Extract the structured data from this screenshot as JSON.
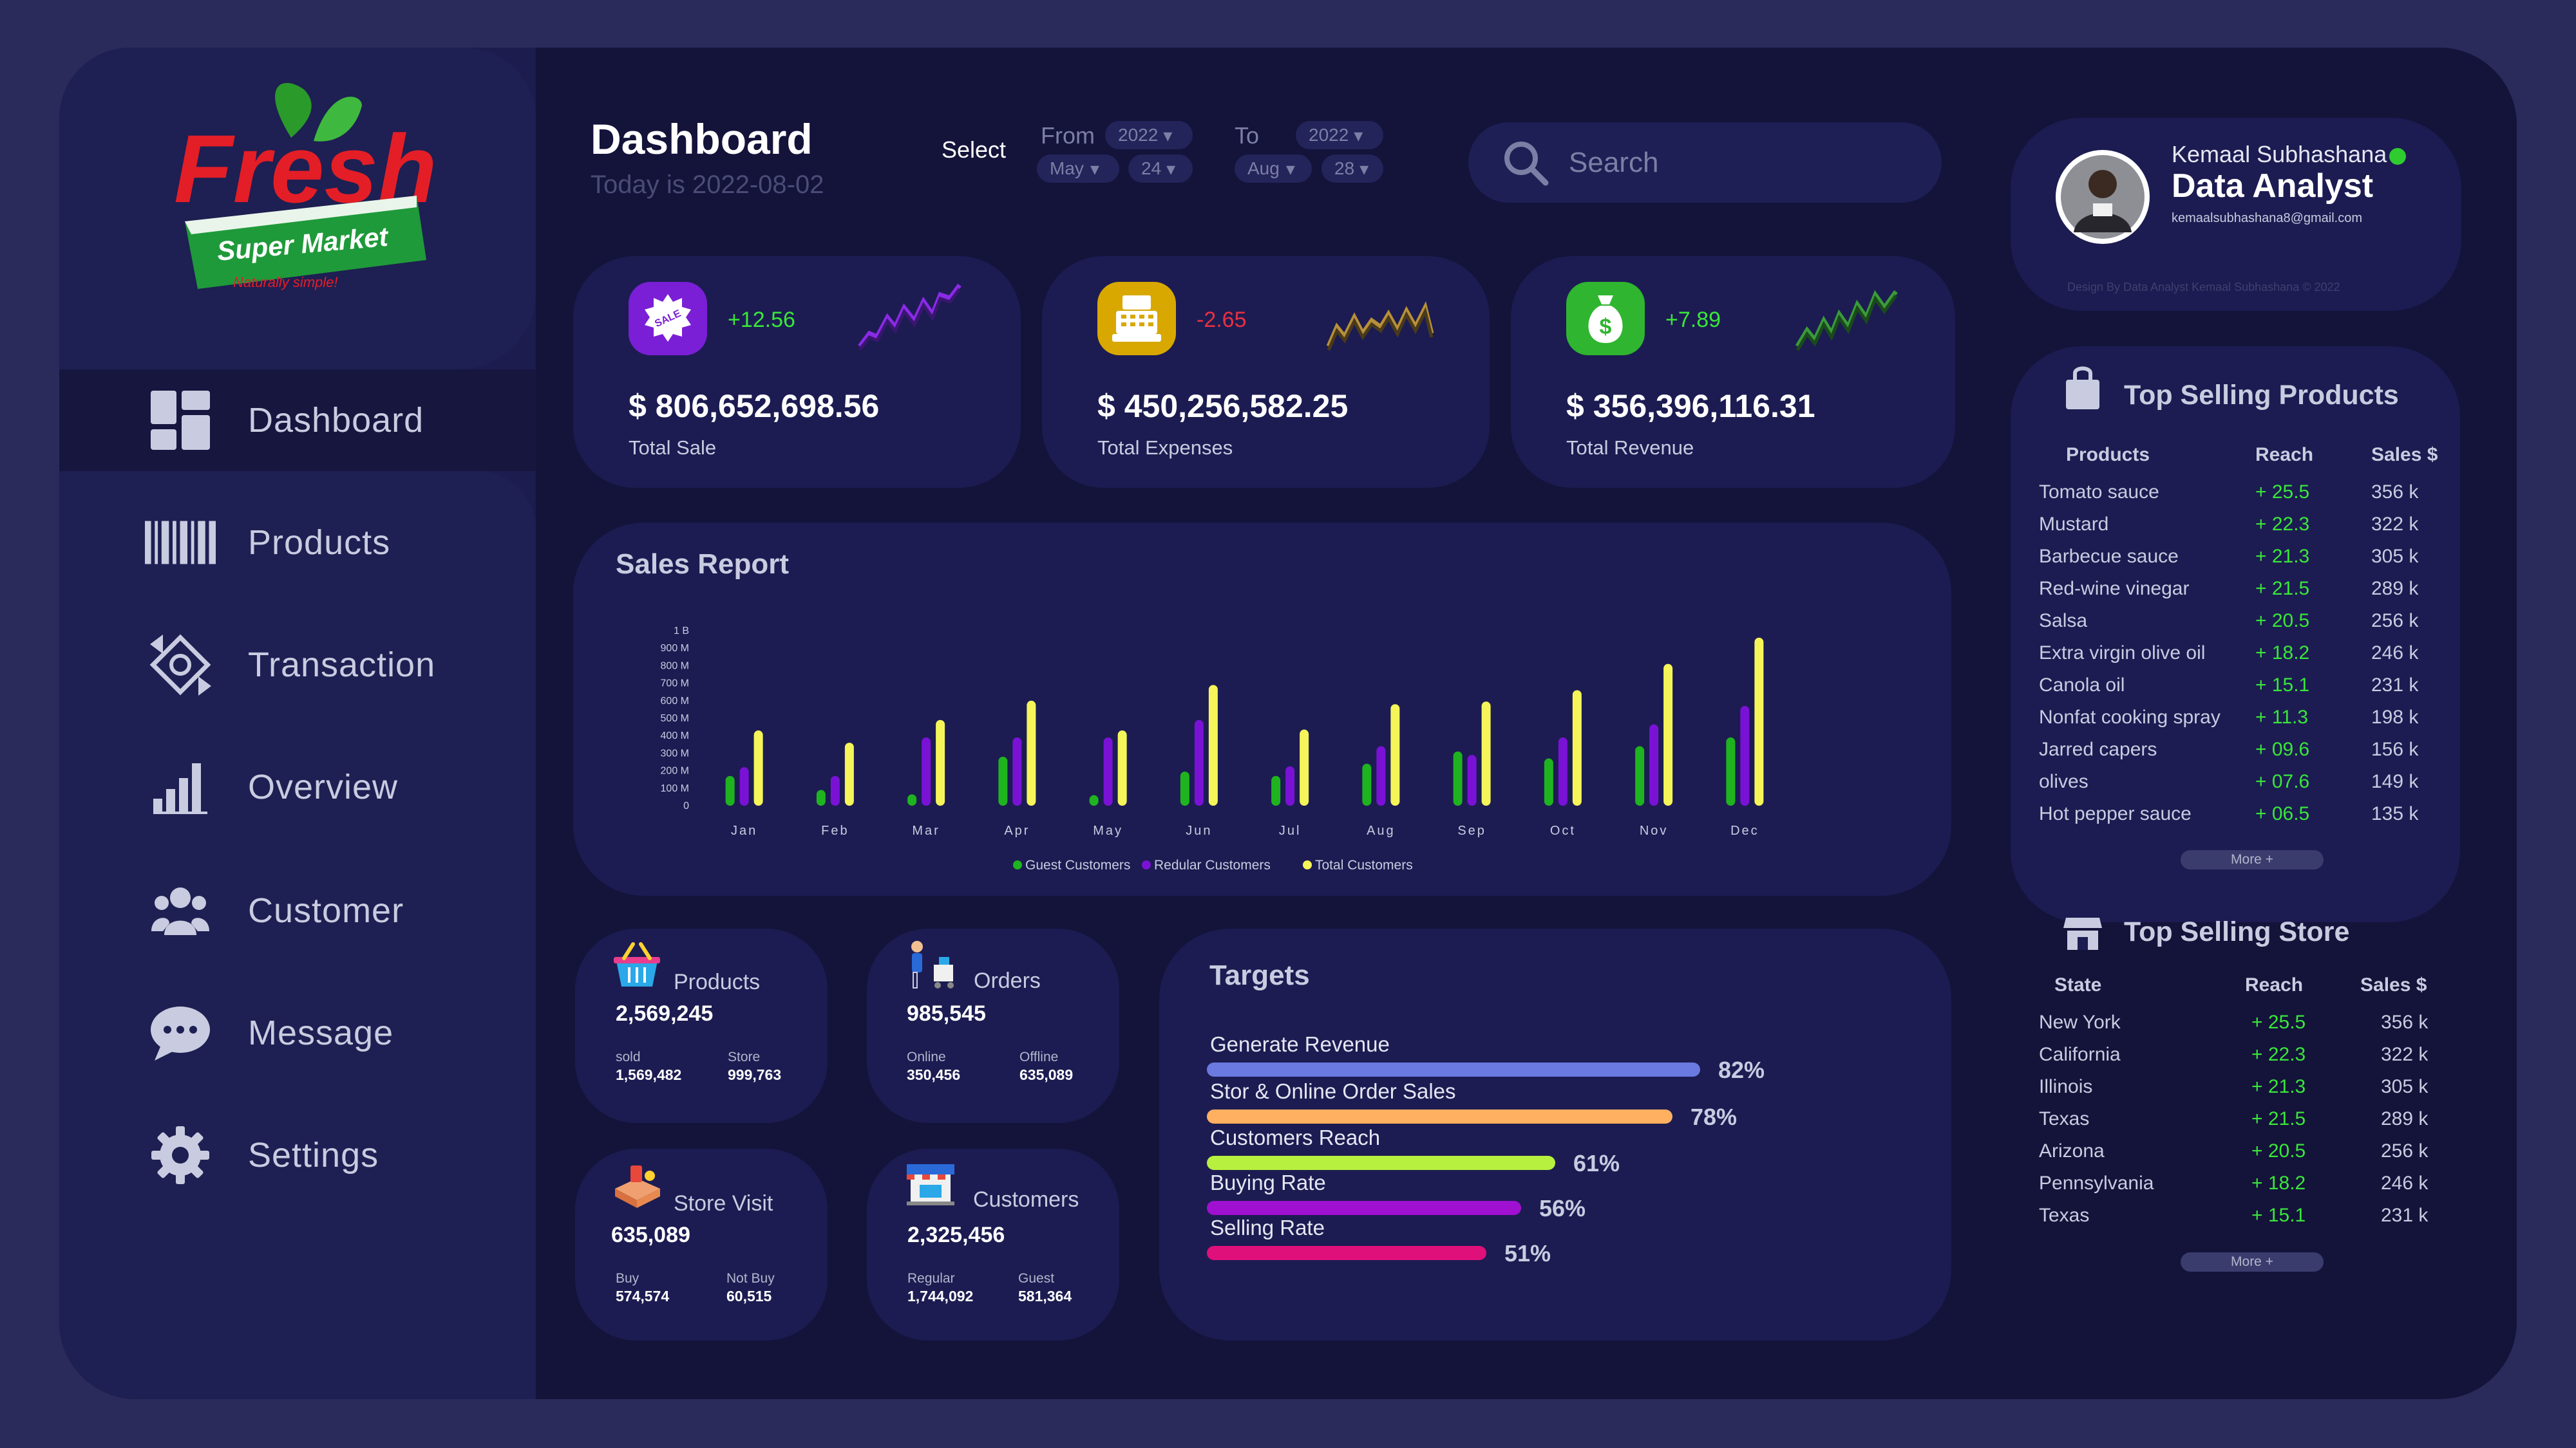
{
  "brand": {
    "name": "Fresh",
    "tagline": "Super Market",
    "slogan": "Naturally simple!"
  },
  "nav": [
    {
      "label": "Dashboard",
      "icon": "dashboard-icon"
    },
    {
      "label": "Products",
      "icon": "barcode-icon"
    },
    {
      "label": "Transaction",
      "icon": "transaction-icon"
    },
    {
      "label": "Overview",
      "icon": "bar-chart-icon"
    },
    {
      "label": "Customer",
      "icon": "users-icon"
    },
    {
      "label": "Message",
      "icon": "chat-icon"
    },
    {
      "label": "Settings",
      "icon": "gear-icon"
    }
  ],
  "header": {
    "title": "Dashboard",
    "subtitle": "Today is 2022-08-02",
    "select_label": "Select",
    "from_label": "From",
    "to_label": "To",
    "from_year": "2022",
    "from_month": "May",
    "from_day": "24",
    "to_year": "2022",
    "to_month": "Aug",
    "to_day": "28"
  },
  "search": {
    "placeholder": "Search"
  },
  "profile": {
    "name": "Kemaal Subhashana",
    "role": "Data Analyst",
    "email": "kemaalsubhashana8@gmail.com",
    "credit": "Design By Data Analyst Kemaal Subhashana © 2022",
    "status": "online"
  },
  "kpis": [
    {
      "change": "+12.56",
      "value": "$ 806,652,698.56",
      "label": "Total Sale",
      "icon": "sale-tag-icon",
      "color": "#7a1fd6",
      "trend": "up"
    },
    {
      "change": "-2.65",
      "value": "$ 450,256,582.25",
      "label": "Total Expenses",
      "icon": "cash-register-icon",
      "color": "#d8a800",
      "trend": "down"
    },
    {
      "change": "+7.89",
      "value": "$ 356,396,116.31",
      "label": "Total Revenue",
      "icon": "money-bag-icon",
      "color": "#2fb52f",
      "trend": "up"
    }
  ],
  "sales_report": {
    "title": "Sales Report"
  },
  "chart_data": {
    "type": "bar",
    "categories": [
      "Jan",
      "Feb",
      "Mar",
      "Apr",
      "May",
      "Jun",
      "Jul",
      "Aug",
      "Sep",
      "Oct",
      "Nov",
      "Dec"
    ],
    "series": [
      {
        "name": "Guest Customers",
        "color": "#1fb41f",
        "values": [
          170,
          90,
          65,
          280,
          60,
          195,
          170,
          240,
          310,
          270,
          340,
          390
        ]
      },
      {
        "name": "Redular Customers",
        "color": "#7a12d6",
        "values": [
          220,
          170,
          390,
          390,
          390,
          490,
          225,
          340,
          290,
          390,
          465,
          570
        ]
      },
      {
        "name": "Total Customers",
        "color": "#f5f55a",
        "values": [
          430,
          360,
          490,
          600,
          430,
          690,
          435,
          580,
          595,
          660,
          810,
          960
        ]
      }
    ],
    "yticks": [
      "1 B",
      "900 M",
      "800 M",
      "700 M",
      "600 M",
      "500 M",
      "400 M",
      "300 M",
      "200 M",
      "100 M",
      "0"
    ],
    "ylim": [
      0,
      1000
    ],
    "units": "M",
    "legend": "bottom"
  },
  "small_cards": [
    {
      "title": "Products",
      "value": "2,569,245",
      "sub1_label": "sold",
      "sub1_value": "1,569,482",
      "sub2_label": "Store",
      "sub2_value": "999,763",
      "icon": "basket-icon"
    },
    {
      "title": "Orders",
      "value": "985,545",
      "sub1_label": "Online",
      "sub1_value": "350,456",
      "sub2_label": "Offline",
      "sub2_value": "635,089",
      "icon": "delivery-icon"
    },
    {
      "title": "Store Visit",
      "value": "635,089",
      "sub1_label": "Buy",
      "sub1_value": "574,574",
      "sub2_label": "Not Buy",
      "sub2_value": "60,515",
      "icon": "store-visit-icon"
    },
    {
      "title": "Customers",
      "value": "2,325,456",
      "sub1_label": "Regular",
      "sub1_value": "1,744,092",
      "sub2_label": "Guest",
      "sub2_value": "581,364",
      "icon": "shop-icon"
    }
  ],
  "targets": {
    "title": "Targets",
    "items": [
      {
        "label": "Generate Revenue",
        "pct": "82%",
        "value": 0.82,
        "color": "#6a7ae0"
      },
      {
        "label": "Stor & Online Order Sales",
        "pct": "78%",
        "value": 0.78,
        "color": "#ffb060"
      },
      {
        "label": "Customers Reach",
        "pct": "61%",
        "value": 0.61,
        "color": "#b8f040"
      },
      {
        "label": "Buying Rate",
        "pct": "56%",
        "value": 0.56,
        "color": "#a010d0"
      },
      {
        "label": "Selling Rate",
        "pct": "51%",
        "value": 0.51,
        "color": "#e0107a"
      }
    ]
  },
  "top_products": {
    "title": "Top Selling Products",
    "headers": [
      "Products",
      "Reach",
      "Sales $"
    ],
    "rows": [
      [
        "Tomato sauce",
        "+ 25.5",
        "356 k"
      ],
      [
        "Mustard",
        "+ 22.3",
        "322 k"
      ],
      [
        "Barbecue sauce",
        "+ 21.3",
        "305 k"
      ],
      [
        "Red-wine vinegar",
        "+ 21.5",
        "289 k"
      ],
      [
        "Salsa",
        "+ 20.5",
        "256 k"
      ],
      [
        "Extra virgin olive oil",
        "+ 18.2",
        "246 k"
      ],
      [
        "Canola oil",
        "+ 15.1",
        "231 k"
      ],
      [
        "Nonfat cooking spray",
        "+ 11.3",
        "198 k"
      ],
      [
        "Jarred capers",
        "+ 09.6",
        "156 k"
      ],
      [
        "olives",
        "+ 07.6",
        "149 k"
      ],
      [
        "Hot pepper sauce",
        "+ 06.5",
        "135 k"
      ]
    ],
    "more": "More +"
  },
  "top_stores": {
    "title": "Top Selling Store",
    "headers": [
      "State",
      "Reach",
      "Sales $"
    ],
    "rows": [
      [
        "New York",
        "+ 25.5",
        "356 k"
      ],
      [
        "California",
        "+ 22.3",
        "322 k"
      ],
      [
        "Illinois",
        "+ 21.3",
        "305 k"
      ],
      [
        "Texas",
        "+ 21.5",
        "289 k"
      ],
      [
        "Arizona",
        "+ 20.5",
        "256 k"
      ],
      [
        "Pennsylvania",
        "+ 18.2",
        "246 k"
      ],
      [
        "Texas",
        "+ 15.1",
        "231 k"
      ]
    ],
    "more": "More +"
  }
}
